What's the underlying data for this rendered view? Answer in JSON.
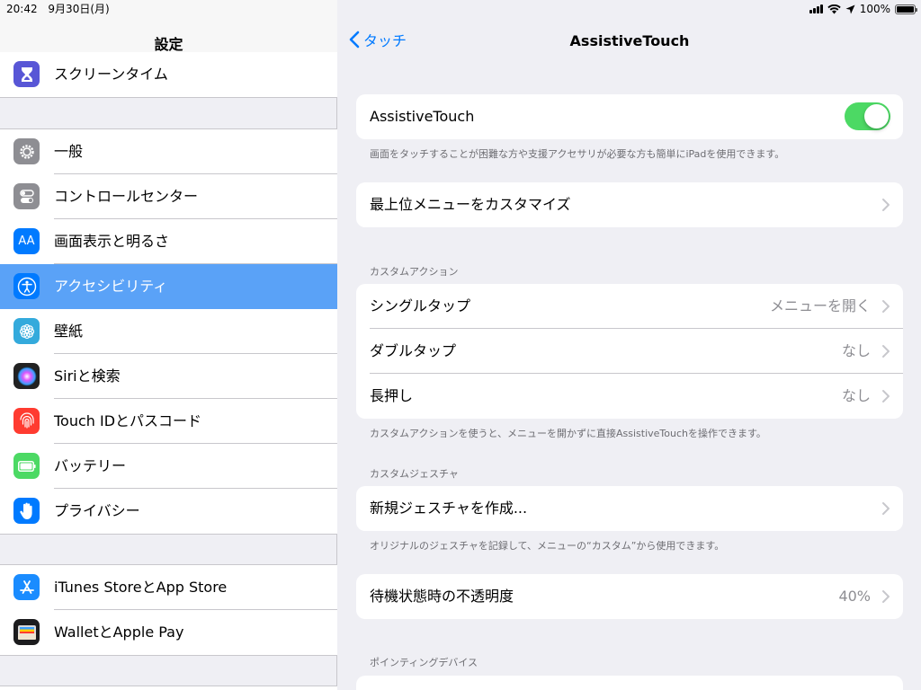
{
  "status_bar": {
    "time": "20:42",
    "date": "9月30日(月)",
    "battery": "100%"
  },
  "sidebar": {
    "title": "設定",
    "groups": [
      {
        "items": [
          {
            "label": "スクリーンタイム",
            "icon": "hourglass-icon",
            "color": "#5856d6"
          }
        ]
      },
      {
        "items": [
          {
            "label": "一般",
            "icon": "gear-icon",
            "color": "#8e8e93"
          },
          {
            "label": "コントロールセンター",
            "icon": "toggles-icon",
            "color": "#8e8e93"
          },
          {
            "label": "画面表示と明るさ",
            "icon": "text-size-icon",
            "color": "#007aff"
          },
          {
            "label": "アクセシビリティ",
            "icon": "accessibility-icon",
            "color": "#007aff",
            "selected": true
          },
          {
            "label": "壁紙",
            "icon": "flower-icon",
            "color": "#34aadc"
          },
          {
            "label": "Siriと検索",
            "icon": "siri-icon",
            "color": "#222222"
          },
          {
            "label": "Touch IDとパスコード",
            "icon": "fingerprint-icon",
            "color": "#ff3b30"
          },
          {
            "label": "バッテリー",
            "icon": "battery-icon",
            "color": "#4cd964"
          },
          {
            "label": "プライバシー",
            "icon": "hand-icon",
            "color": "#007aff"
          }
        ]
      },
      {
        "items": [
          {
            "label": "iTunes StoreとApp Store",
            "icon": "app-store-icon",
            "color": "#1a8cff"
          },
          {
            "label": "WalletとApple Pay",
            "icon": "wallet-icon",
            "color": "#1c1c1e"
          }
        ]
      }
    ]
  },
  "detail": {
    "back_label": "タッチ",
    "title": "AssistiveTouch",
    "toggle_row": {
      "label": "AssistiveTouch",
      "enabled": true
    },
    "toggle_footer": "画面をタッチすることが困難な方や支援アクセサリが必要な方も簡単にiPadを使用できます。",
    "customize_row": {
      "label": "最上位メニューをカスタマイズ"
    },
    "custom_actions_header": "カスタムアクション",
    "custom_actions": [
      {
        "label": "シングルタップ",
        "value": "メニューを開く"
      },
      {
        "label": "ダブルタップ",
        "value": "なし"
      },
      {
        "label": "長押し",
        "value": "なし"
      }
    ],
    "custom_actions_footer": "カスタムアクションを使うと、メニューを開かずに直接AssistiveTouchを操作できます。",
    "custom_gestures_header": "カスタムジェスチャ",
    "new_gesture_row": {
      "label": "新規ジェスチャを作成..."
    },
    "custom_gestures_footer": "オリジナルのジェスチャを記録して、メニューの“カスタム”から使用できます。",
    "opacity_row": {
      "label": "待機状態時の不透明度",
      "value": "40%"
    },
    "pointing_devices_header": "ポインティングデバイス"
  }
}
